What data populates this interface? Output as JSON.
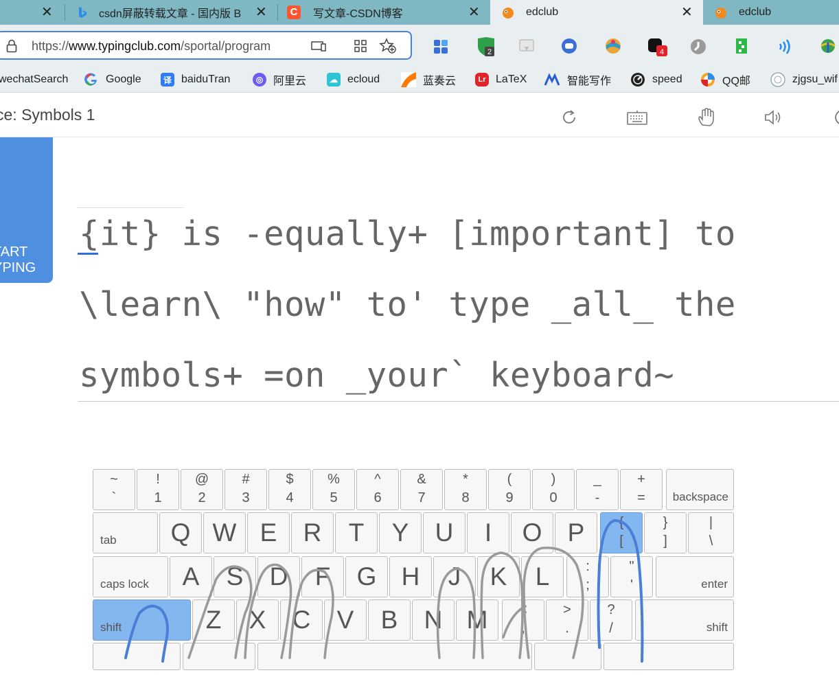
{
  "browser": {
    "tabs": [
      {
        "title": "csdn屏蔽转载文章 - 国内版 B",
        "icon": "bing-icon",
        "active": false
      },
      {
        "title": "写文章-CSDN博客",
        "icon": "csdn-icon",
        "active": false
      },
      {
        "title": "edclub",
        "icon": "edclub-icon",
        "active": true
      },
      {
        "title": "edclub",
        "icon": "edclub-icon",
        "active": false
      }
    ],
    "url_scheme": "https://",
    "url_host": "www.typingclub.com",
    "url_path": "/sportal/program"
  },
  "bookmarks": [
    {
      "label": "wechatSearch",
      "color": ""
    },
    {
      "label": "Google",
      "color": "#4285f4"
    },
    {
      "label": "baiduTran",
      "color": "#2f7cf6"
    },
    {
      "label": "阿里云",
      "color": "#6b5bf0"
    },
    {
      "label": "ecloud",
      "color": "#2ec4d6"
    },
    {
      "label": "蓝奏云",
      "color": "#ff7a00"
    },
    {
      "label": "LaTeX",
      "color": "#e0242a"
    },
    {
      "label": "智能写作",
      "color": "#2a5bd7"
    },
    {
      "label": "speed",
      "color": "#222222"
    },
    {
      "label": "QQ邮",
      "color": "#f5a623"
    },
    {
      "label": "zjgsu_wif",
      "color": "#9aa9b8"
    }
  ],
  "lesson": {
    "title": "ce: Symbols 1",
    "start_line1": "TART",
    "start_line2": "YPING"
  },
  "typing_text": {
    "lines": [
      "{it} is -equally+ [important] to",
      "\\learn\\ \"how\" to' type _all_ the",
      "symbols+ =on _your` keyboard~"
    ]
  },
  "keyboard": {
    "row1": [
      {
        "top": "~",
        "bot": "`"
      },
      {
        "top": "!",
        "bot": "1"
      },
      {
        "top": "@",
        "bot": "2"
      },
      {
        "top": "#",
        "bot": "3"
      },
      {
        "top": "$",
        "bot": "4"
      },
      {
        "top": "%",
        "bot": "5"
      },
      {
        "top": "^",
        "bot": "6"
      },
      {
        "top": "&",
        "bot": "7"
      },
      {
        "top": "*",
        "bot": "8"
      },
      {
        "top": "(",
        "bot": "9"
      },
      {
        "top": ")",
        "bot": "0"
      },
      {
        "top": "_",
        "bot": "-"
      },
      {
        "top": "+",
        "bot": "="
      }
    ],
    "backspace": "backspace",
    "tab": "tab",
    "row2": [
      "Q",
      "W",
      "E",
      "R",
      "T",
      "Y",
      "U",
      "I",
      "O",
      "P"
    ],
    "row2_sym": [
      {
        "top": "{",
        "bot": "["
      },
      {
        "top": "}",
        "bot": "]"
      },
      {
        "top": "|",
        "bot": "\\"
      }
    ],
    "caps": "caps lock",
    "row3": [
      "A",
      "S",
      "D",
      "F",
      "G",
      "H",
      "J",
      "K",
      "L"
    ],
    "row3_sym": [
      {
        "top": ":",
        "bot": ";"
      },
      {
        "top": "\"",
        "bot": "'"
      }
    ],
    "enter": "enter",
    "shift_left": "shift",
    "row4": [
      "Z",
      "X",
      "C",
      "V",
      "B",
      "N",
      "M"
    ],
    "row4_sym": [
      {
        "top": "<",
        "bot": ","
      },
      {
        "top": ">",
        "bot": "."
      },
      {
        "top": "?",
        "bot": "/"
      }
    ],
    "shift_right": "shift",
    "highlighted_keys": [
      "[",
      "shift-left"
    ]
  }
}
